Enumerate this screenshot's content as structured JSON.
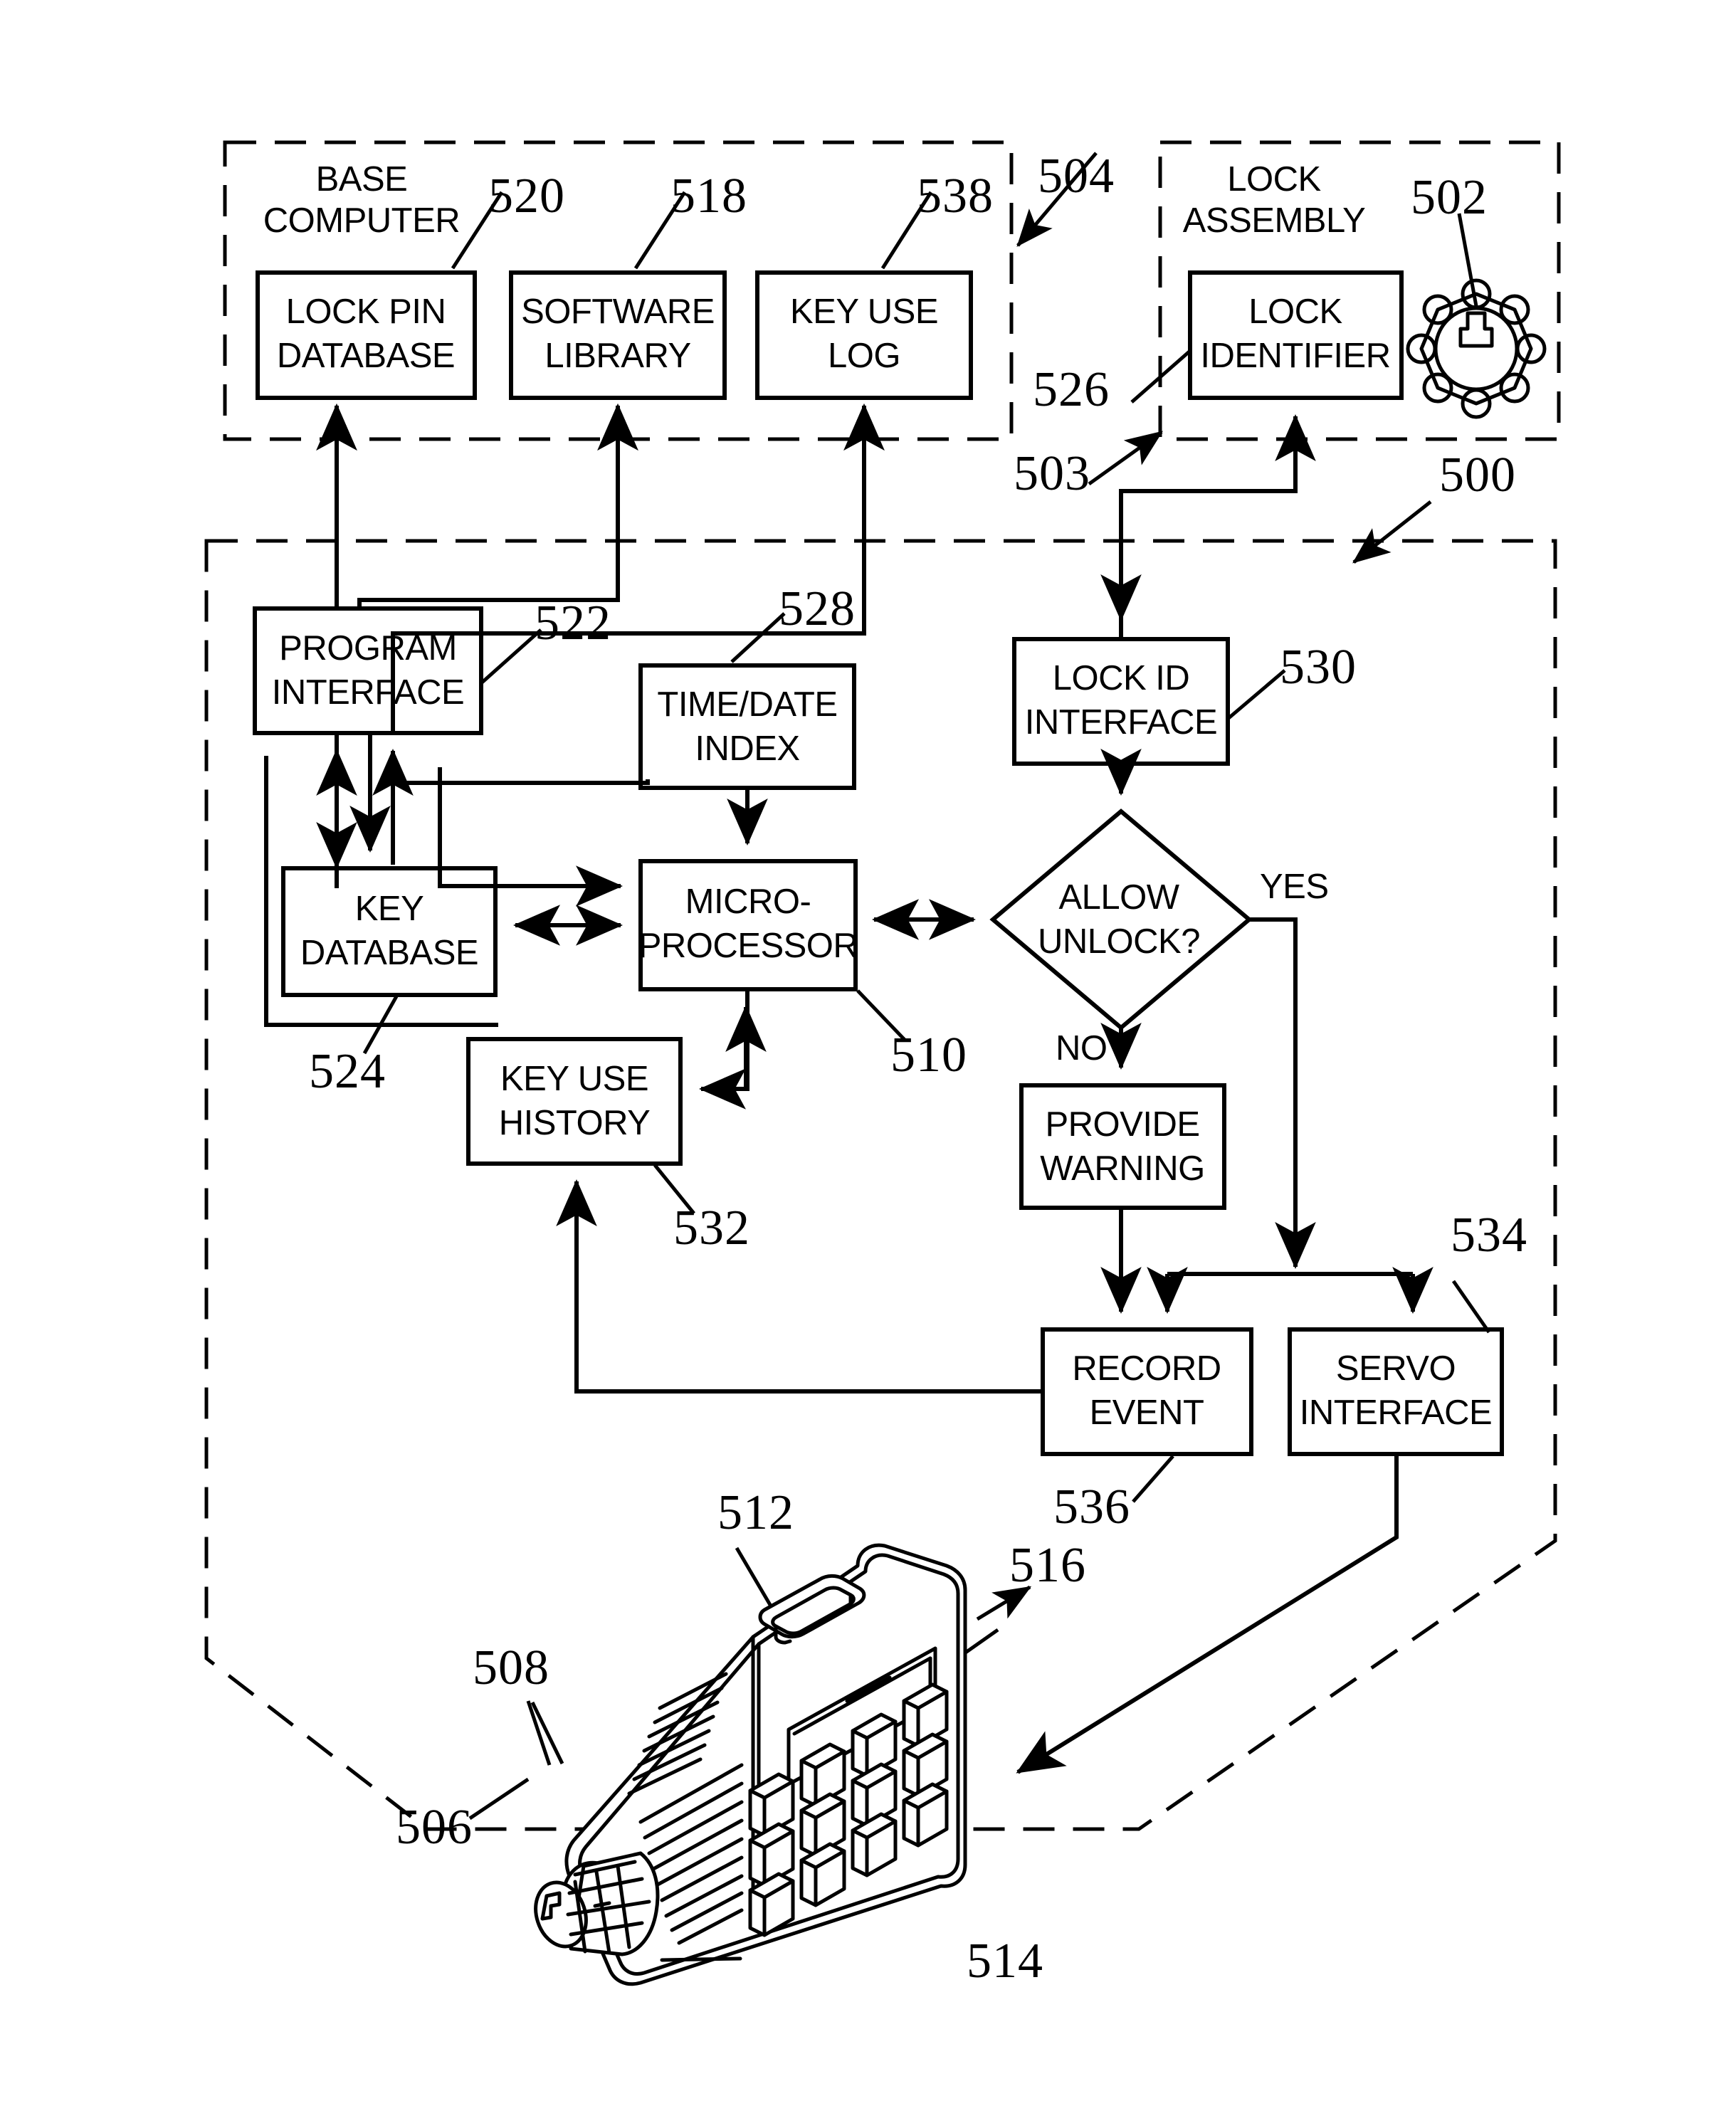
{
  "figure": {
    "groups": [
      {
        "id": "base-computer",
        "label_line1": "BASE",
        "label_line2": "COMPUTER",
        "ref": "504"
      },
      {
        "id": "lock-assembly",
        "label_line1": "LOCK",
        "label_line2": "ASSEMBLY",
        "ref": "503"
      },
      {
        "id": "electronic-key",
        "ref": "500"
      }
    ],
    "boxes": [
      {
        "id": "lock-pin-database",
        "line1": "LOCK PIN",
        "line2": "DATABASE",
        "ref": "520"
      },
      {
        "id": "software-library",
        "line1": "SOFTWARE",
        "line2": "LIBRARY",
        "ref": "518"
      },
      {
        "id": "key-use-log",
        "line1": "KEY USE",
        "line2": "LOG",
        "ref": "538"
      },
      {
        "id": "lock-identifier",
        "line1": "LOCK",
        "line2": "IDENTIFIER",
        "ref": "526"
      },
      {
        "id": "program-interface",
        "line1": "PROGRAM",
        "line2": "INTERFACE",
        "ref": "522"
      },
      {
        "id": "time-date-index",
        "line1": "TIME/DATE",
        "line2": "INDEX",
        "ref": "528"
      },
      {
        "id": "lock-id-interface",
        "line1": "LOCK ID",
        "line2": "INTERFACE",
        "ref": "530"
      },
      {
        "id": "key-database",
        "line1": "KEY",
        "line2": "DATABASE",
        "ref": "524"
      },
      {
        "id": "microprocessor",
        "line1": "MICRO-",
        "line2": "PROCESSOR",
        "ref": "510"
      },
      {
        "id": "key-use-history",
        "line1": "KEY USE",
        "line2": "HISTORY",
        "ref": "532"
      },
      {
        "id": "provide-warning",
        "line1": "PROVIDE",
        "line2": "WARNING",
        "ref": ""
      },
      {
        "id": "record-event",
        "line1": "RECORD",
        "line2": "EVENT",
        "ref": "536"
      },
      {
        "id": "servo-interface",
        "line1": "SERVO",
        "line2": "INTERFACE",
        "ref": "534"
      }
    ],
    "decision": {
      "id": "allow-unlock",
      "line1": "ALLOW",
      "line2": "UNLOCK?",
      "yes": "YES",
      "no": "NO"
    },
    "device_refs": [
      {
        "id": "key-housing-slot",
        "ref": "512"
      },
      {
        "id": "key-display",
        "ref": "516"
      },
      {
        "id": "key-keypad",
        "ref": "514"
      },
      {
        "id": "key-bit-tip",
        "ref": "508"
      },
      {
        "id": "key-cylinder",
        "ref": "506"
      }
    ],
    "lock_icon": {
      "id": "lock-cylinder-icon",
      "ref": "502"
    },
    "colors": {
      "ink": "#000000",
      "paper": "#ffffff"
    }
  }
}
